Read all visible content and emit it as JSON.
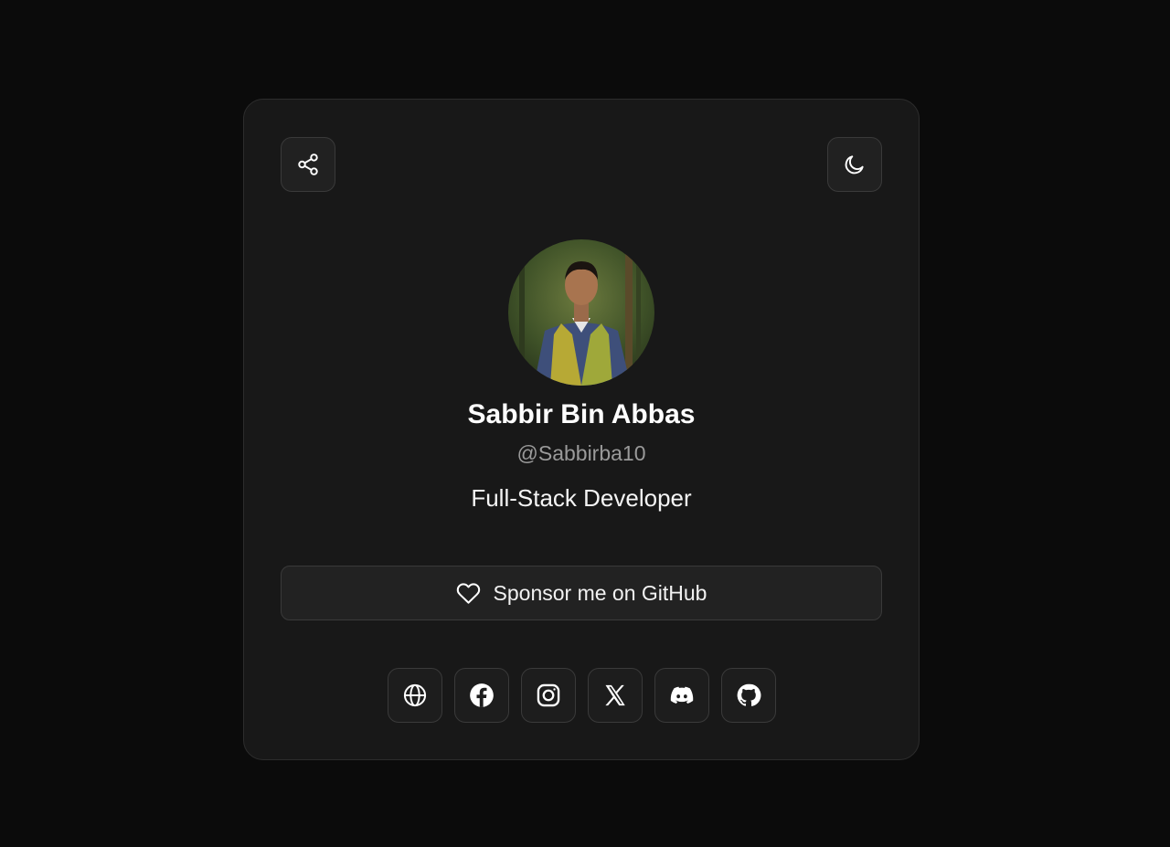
{
  "profile": {
    "name": "Sabbir Bin Abbas",
    "handle": "@Sabbirba10",
    "role": "Full-Stack Developer"
  },
  "header": {
    "share_icon": "share-icon",
    "theme_icon": "moon-icon"
  },
  "sponsor": {
    "label": "Sponsor me on GitHub",
    "icon": "heart-icon"
  },
  "socials": [
    {
      "icon": "globe-icon"
    },
    {
      "icon": "facebook-icon"
    },
    {
      "icon": "instagram-icon"
    },
    {
      "icon": "x-icon"
    },
    {
      "icon": "discord-icon"
    },
    {
      "icon": "github-icon"
    }
  ],
  "colors": {
    "background": "#0b0b0b",
    "card": "#181818",
    "border": "#3a3a3a",
    "muted_text": "#9a9a9a"
  }
}
